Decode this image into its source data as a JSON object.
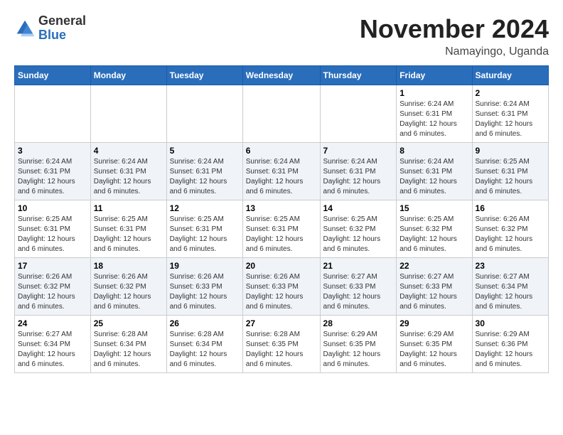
{
  "header": {
    "logo_general": "General",
    "logo_blue": "Blue",
    "title": "November 2024",
    "subtitle": "Namayingo, Uganda"
  },
  "days_of_week": [
    "Sunday",
    "Monday",
    "Tuesday",
    "Wednesday",
    "Thursday",
    "Friday",
    "Saturday"
  ],
  "weeks": [
    [
      {
        "day": "",
        "info": ""
      },
      {
        "day": "",
        "info": ""
      },
      {
        "day": "",
        "info": ""
      },
      {
        "day": "",
        "info": ""
      },
      {
        "day": "",
        "info": ""
      },
      {
        "day": "1",
        "info": "Sunrise: 6:24 AM\nSunset: 6:31 PM\nDaylight: 12 hours and 6 minutes."
      },
      {
        "day": "2",
        "info": "Sunrise: 6:24 AM\nSunset: 6:31 PM\nDaylight: 12 hours and 6 minutes."
      }
    ],
    [
      {
        "day": "3",
        "info": "Sunrise: 6:24 AM\nSunset: 6:31 PM\nDaylight: 12 hours and 6 minutes."
      },
      {
        "day": "4",
        "info": "Sunrise: 6:24 AM\nSunset: 6:31 PM\nDaylight: 12 hours and 6 minutes."
      },
      {
        "day": "5",
        "info": "Sunrise: 6:24 AM\nSunset: 6:31 PM\nDaylight: 12 hours and 6 minutes."
      },
      {
        "day": "6",
        "info": "Sunrise: 6:24 AM\nSunset: 6:31 PM\nDaylight: 12 hours and 6 minutes."
      },
      {
        "day": "7",
        "info": "Sunrise: 6:24 AM\nSunset: 6:31 PM\nDaylight: 12 hours and 6 minutes."
      },
      {
        "day": "8",
        "info": "Sunrise: 6:24 AM\nSunset: 6:31 PM\nDaylight: 12 hours and 6 minutes."
      },
      {
        "day": "9",
        "info": "Sunrise: 6:25 AM\nSunset: 6:31 PM\nDaylight: 12 hours and 6 minutes."
      }
    ],
    [
      {
        "day": "10",
        "info": "Sunrise: 6:25 AM\nSunset: 6:31 PM\nDaylight: 12 hours and 6 minutes."
      },
      {
        "day": "11",
        "info": "Sunrise: 6:25 AM\nSunset: 6:31 PM\nDaylight: 12 hours and 6 minutes."
      },
      {
        "day": "12",
        "info": "Sunrise: 6:25 AM\nSunset: 6:31 PM\nDaylight: 12 hours and 6 minutes."
      },
      {
        "day": "13",
        "info": "Sunrise: 6:25 AM\nSunset: 6:31 PM\nDaylight: 12 hours and 6 minutes."
      },
      {
        "day": "14",
        "info": "Sunrise: 6:25 AM\nSunset: 6:32 PM\nDaylight: 12 hours and 6 minutes."
      },
      {
        "day": "15",
        "info": "Sunrise: 6:25 AM\nSunset: 6:32 PM\nDaylight: 12 hours and 6 minutes."
      },
      {
        "day": "16",
        "info": "Sunrise: 6:26 AM\nSunset: 6:32 PM\nDaylight: 12 hours and 6 minutes."
      }
    ],
    [
      {
        "day": "17",
        "info": "Sunrise: 6:26 AM\nSunset: 6:32 PM\nDaylight: 12 hours and 6 minutes."
      },
      {
        "day": "18",
        "info": "Sunrise: 6:26 AM\nSunset: 6:32 PM\nDaylight: 12 hours and 6 minutes."
      },
      {
        "day": "19",
        "info": "Sunrise: 6:26 AM\nSunset: 6:33 PM\nDaylight: 12 hours and 6 minutes."
      },
      {
        "day": "20",
        "info": "Sunrise: 6:26 AM\nSunset: 6:33 PM\nDaylight: 12 hours and 6 minutes."
      },
      {
        "day": "21",
        "info": "Sunrise: 6:27 AM\nSunset: 6:33 PM\nDaylight: 12 hours and 6 minutes."
      },
      {
        "day": "22",
        "info": "Sunrise: 6:27 AM\nSunset: 6:33 PM\nDaylight: 12 hours and 6 minutes."
      },
      {
        "day": "23",
        "info": "Sunrise: 6:27 AM\nSunset: 6:34 PM\nDaylight: 12 hours and 6 minutes."
      }
    ],
    [
      {
        "day": "24",
        "info": "Sunrise: 6:27 AM\nSunset: 6:34 PM\nDaylight: 12 hours and 6 minutes."
      },
      {
        "day": "25",
        "info": "Sunrise: 6:28 AM\nSunset: 6:34 PM\nDaylight: 12 hours and 6 minutes."
      },
      {
        "day": "26",
        "info": "Sunrise: 6:28 AM\nSunset: 6:34 PM\nDaylight: 12 hours and 6 minutes."
      },
      {
        "day": "27",
        "info": "Sunrise: 6:28 AM\nSunset: 6:35 PM\nDaylight: 12 hours and 6 minutes."
      },
      {
        "day": "28",
        "info": "Sunrise: 6:29 AM\nSunset: 6:35 PM\nDaylight: 12 hours and 6 minutes."
      },
      {
        "day": "29",
        "info": "Sunrise: 6:29 AM\nSunset: 6:35 PM\nDaylight: 12 hours and 6 minutes."
      },
      {
        "day": "30",
        "info": "Sunrise: 6:29 AM\nSunset: 6:36 PM\nDaylight: 12 hours and 6 minutes."
      }
    ]
  ]
}
